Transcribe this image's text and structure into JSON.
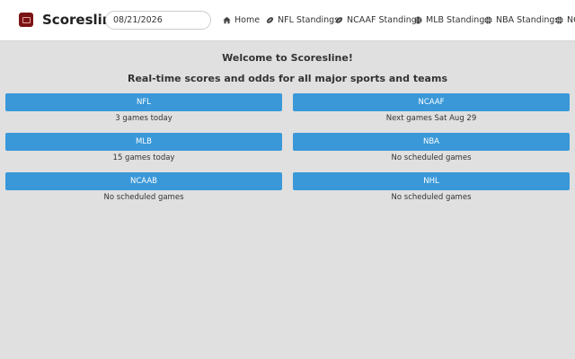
{
  "header": {
    "brand": "Scoresline",
    "date_value": "08/21/2026",
    "nav": [
      {
        "label": "Home",
        "icon": "home-icon"
      },
      {
        "label": "NFL Standings",
        "icon": "football-icon"
      },
      {
        "label": "NCAAF Standings",
        "icon": "football-icon"
      },
      {
        "label": "MLB Standings",
        "icon": "baseball-icon"
      },
      {
        "label": "NBA Standings",
        "icon": "basketball-icon"
      },
      {
        "label": "NC",
        "icon": "basketball-icon"
      }
    ]
  },
  "main": {
    "welcome": "Welcome to Scoresline!",
    "tagline": "Real-time scores and odds for all major sports and teams",
    "sports": [
      {
        "label": "NFL",
        "status": "3 games today"
      },
      {
        "label": "NCAAF",
        "status": "Next games Sat Aug 29"
      },
      {
        "label": "MLB",
        "status": "15 games today"
      },
      {
        "label": "NBA",
        "status": "No scheduled games"
      },
      {
        "label": "NCAAB",
        "status": "No scheduled games"
      },
      {
        "label": "NHL",
        "status": "No scheduled games"
      }
    ]
  },
  "colors": {
    "accent": "#3a98d8",
    "background": "#e0e0e0",
    "navbar": "#ffffff",
    "logo": "#7a1414"
  }
}
